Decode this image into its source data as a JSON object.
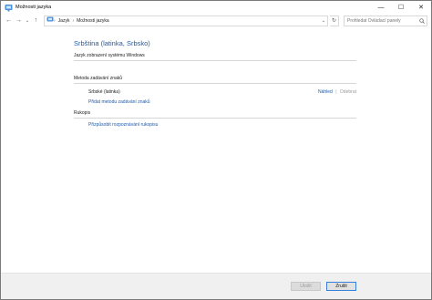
{
  "window": {
    "title": "Možnosti jazyka",
    "minimize_glyph": "—",
    "maximize_glyph": "☐",
    "close_glyph": "✕"
  },
  "nav": {
    "back_glyph": "←",
    "forward_glyph": "→",
    "recent_glyph": "⌄",
    "up_glyph": "↑",
    "refresh_glyph": "↻",
    "breadcrumb_sep": "›",
    "dropdown_glyph": "⌄",
    "breadcrumb": [
      "Jazyk",
      "Možnosti jazyka"
    ],
    "search_placeholder": "Prohledat Ovládací panely"
  },
  "main": {
    "language_title": "Srbština (latinka, Srbsko)",
    "display_language_label": "Jazyk zobrazení systému Windows",
    "input_method": {
      "heading": "Metoda zadávání znaků",
      "method_name": "Srbské (latinka)",
      "preview_link": "Náhled",
      "separator": "|",
      "remove_label": "Odebrat",
      "add_link": "Přidat metodu zadávání znaků"
    },
    "handwriting": {
      "heading": "Rukopis",
      "customize_link": "Přizpůsobit rozpoznávání rukopisu"
    }
  },
  "footer": {
    "save_label": "Uložit",
    "cancel_label": "Zrušit"
  },
  "colors": {
    "link": "#1e5aa8",
    "accent_border": "#3c7fd8"
  },
  "icons": {
    "app": "control-panel-icon",
    "search": "search-icon"
  }
}
